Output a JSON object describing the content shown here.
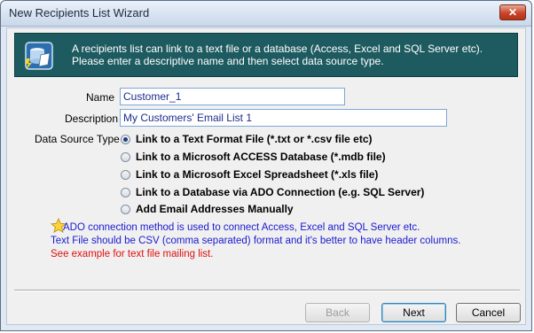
{
  "window": {
    "title": "New Recipients List Wizard",
    "close_label": "✕"
  },
  "banner": {
    "line1": "A recipients list can link to a text file or a database (Access, Excel and SQL Server etc).",
    "line2": "Please enter a descriptive name and then select data source type.",
    "icon": "database-wizard-icon"
  },
  "form": {
    "name_label": "Name",
    "name_value": "Customer_1",
    "description_label": "Description",
    "description_value": "My Customers' Email List 1",
    "source_label": "Data Source Type"
  },
  "options": [
    {
      "label": "Link to a Text Format File (*.txt or *.csv file etc)",
      "selected": true
    },
    {
      "label": "Link to a Microsoft ACCESS Database (*.mdb file)",
      "selected": false
    },
    {
      "label": "Link to a Microsoft Excel Spreadsheet (*.xls file)",
      "selected": false
    },
    {
      "label": "Link to a Database via ADO Connection (e.g. SQL Server)",
      "selected": false
    },
    {
      "label": "Add Email Addresses Manually",
      "selected": false
    }
  ],
  "notes": {
    "line1": "ADO connection method is used to connect Access, Excel and SQL Server etc.",
    "line2": "Text File should be CSV (comma separated) format and it's better to have header columns.",
    "line3": "See example for text file mailing list.",
    "color_info": "#1a1ad0",
    "color_link": "#e01010",
    "icon": "star-note-icon"
  },
  "buttons": {
    "back": "Back",
    "next": "Next",
    "cancel": "Cancel"
  }
}
